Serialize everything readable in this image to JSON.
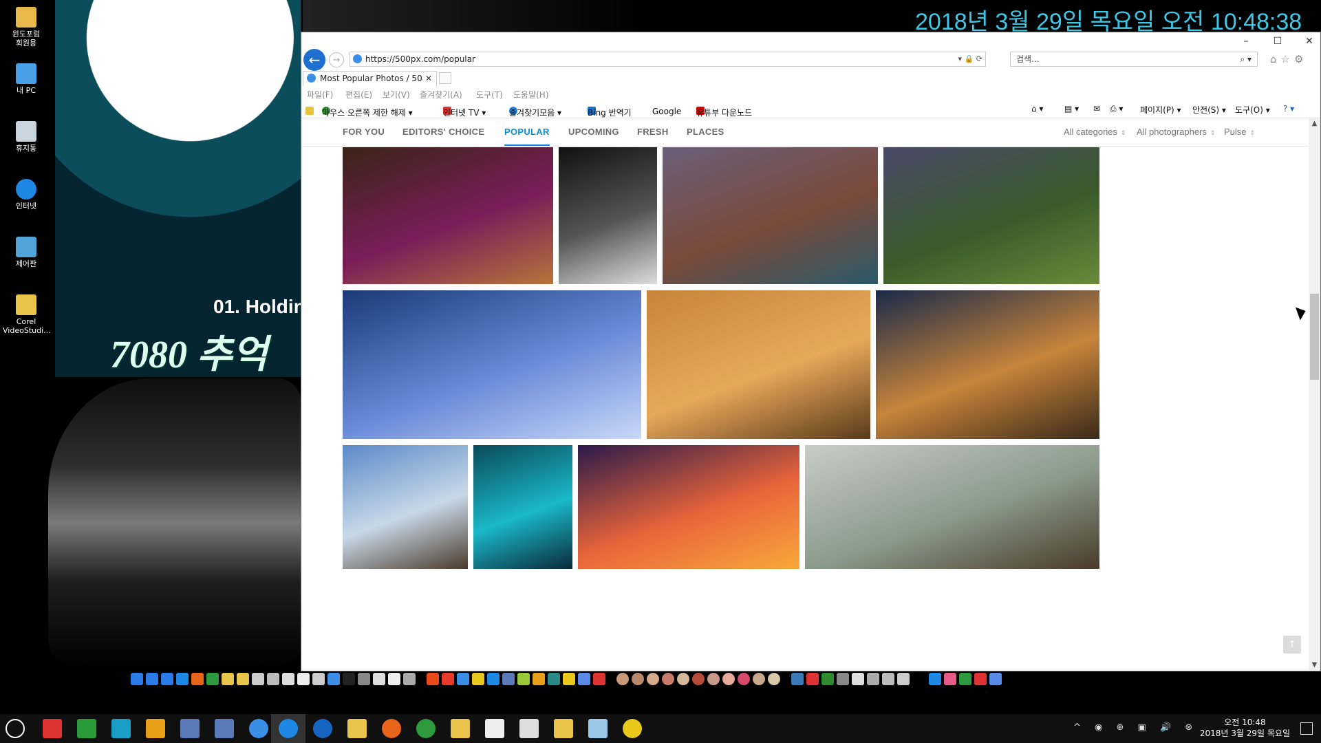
{
  "desktop": {
    "clock_text": "2018년 3월 29일 목요일 오전 10:48:38",
    "wallpaper": {
      "text1": "01. Holdin",
      "text2": "7080 추억"
    },
    "icons": [
      {
        "label": "윈도포럼\n회원용",
        "icon": "folder-icon",
        "color": "#e8b84a"
      },
      {
        "label": "내 PC",
        "icon": "computer-icon",
        "color": "#4aa0e8"
      },
      {
        "label": "휴지통",
        "icon": "recycle-bin-icon",
        "color": "#c9d4dc"
      },
      {
        "label": "인터넷",
        "icon": "internet-explorer-icon",
        "color": "#1e88e5"
      },
      {
        "label": "제어판",
        "icon": "control-panel-icon",
        "color": "#4fa3d9"
      },
      {
        "label": "Corel\nVideoStudi...",
        "icon": "folder-icon",
        "color": "#e8c44a"
      }
    ]
  },
  "browser": {
    "window_controls": {
      "minimize": "–",
      "maximize": "☐",
      "close": "✕"
    },
    "address": "https://500px.com/popular",
    "search_placeholder": "검색...",
    "tab_title": "Most Popular Photos / 50",
    "tab_close": "✕",
    "menu": [
      "파일(F)",
      "편집(E)",
      "보기(V)",
      "즐겨찾기(A)",
      "도구(T)",
      "도움말(H)"
    ],
    "favorites": [
      {
        "label": "마우스 오른쪽 제한 해제 ▾",
        "icon": "tree-icon",
        "color": "#2e8b2e"
      },
      {
        "label": "인터넷 TV ▾",
        "icon": "tv-icon",
        "color": "#d33"
      },
      {
        "label": "즐겨찾기모음 ▾",
        "icon": "ie-icon",
        "color": "#1e88e5"
      },
      {
        "label": "Bing 번역기",
        "icon": "bing-icon",
        "color": "#1a73c8"
      },
      {
        "label": "Google",
        "icon": "google-icon",
        "color": "#fff"
      },
      {
        "label": "유튜부 다운노드",
        "icon": "youtube-icon",
        "color": "#d00"
      }
    ],
    "commands": [
      "페이지(P) ▾",
      "안전(S) ▾",
      "도구(O) ▾"
    ]
  },
  "site": {
    "nav": [
      "FOR YOU",
      "EDITORS' CHOICE",
      "POPULAR",
      "UPCOMING",
      "FRESH",
      "PLACES"
    ],
    "active_nav": "POPULAR",
    "filters": [
      "All categories",
      "All photographers",
      "Pulse"
    ],
    "accent": "#0b8ed8",
    "photos": [
      {
        "name": "girl-portrait-photo",
        "colors": [
          "#3a2416",
          "#7a1d5a",
          "#b8743a"
        ]
      },
      {
        "name": "bw-woman-photo",
        "colors": [
          "#111",
          "#555",
          "#ddd"
        ]
      },
      {
        "name": "coastal-village-photo",
        "colors": [
          "#6b5f7a",
          "#7a4a3a",
          "#2b5a6a"
        ]
      },
      {
        "name": "tea-field-photo",
        "colors": [
          "#4a4a6a",
          "#3a5a2a",
          "#6a8a3a"
        ]
      },
      {
        "name": "glacier-ice-photo",
        "colors": [
          "#1a3a7a",
          "#6a8ad8",
          "#c8d8f8"
        ]
      },
      {
        "name": "tree-reflection-photo",
        "colors": [
          "#c8843a",
          "#e8a85a",
          "#5a3a1a"
        ]
      },
      {
        "name": "woman-on-well-photo",
        "colors": [
          "#1a2a4a",
          "#c8843a",
          "#3a2a1a"
        ]
      },
      {
        "name": "matterhorn-village-photo",
        "colors": [
          "#5a8ac8",
          "#c8d8e8",
          "#4a3a2a"
        ]
      },
      {
        "name": "teal-forest-photo",
        "colors": [
          "#0a4a5a",
          "#1ab8c8",
          "#0a2a3a"
        ]
      },
      {
        "name": "sunset-silhouette-photo",
        "colors": [
          "#2a1a4a",
          "#e8643a",
          "#f8a83a"
        ]
      },
      {
        "name": "misty-pines-photo",
        "colors": [
          "#c8ccc8",
          "#8a9a8a",
          "#4a3a2a"
        ]
      }
    ]
  },
  "taskbar": {
    "tray_time": "오전 10:48",
    "tray_date": "2018년 3월 29일 목요일"
  }
}
